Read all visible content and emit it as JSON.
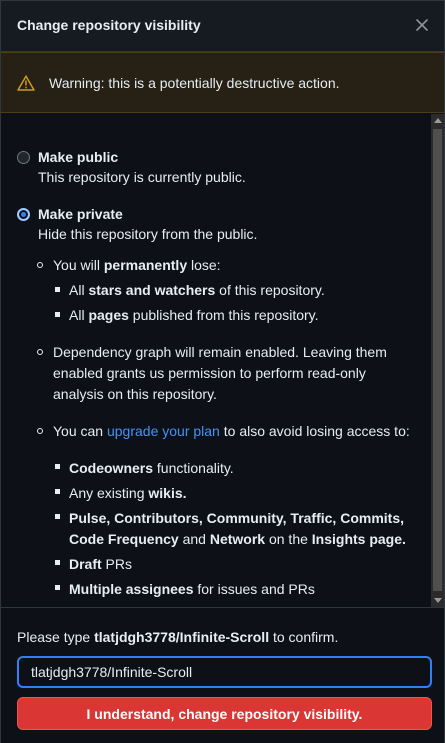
{
  "dialog": {
    "title": "Change repository visibility",
    "close_icon": "close-icon"
  },
  "warning": {
    "icon": "alert-triangle-icon",
    "text": "Warning: this is a potentially destructive action."
  },
  "options": {
    "public": {
      "label": "Make public",
      "note": "This repository is currently public.",
      "checked": false
    },
    "private": {
      "label": "Make private",
      "note": "Hide this repository from the public.",
      "checked": true
    }
  },
  "details": {
    "lose_intro": {
      "pre": "You will ",
      "bold": "permanently",
      "post": " lose:"
    },
    "lose_items": [
      {
        "pre": "All ",
        "bold": "stars and watchers",
        "post": " of this repository."
      },
      {
        "pre": "All ",
        "bold": "pages",
        "post": " published from this repository."
      }
    ],
    "dependency_lines": [
      "Dependency graph will remain enabled. Leaving them",
      "enabled grants us permission to perform read-only",
      "analysis on this repository."
    ],
    "upgrade": {
      "pre": "You can ",
      "link": "upgrade your plan",
      "post": " to also avoid losing access to:"
    },
    "upgrade_items": {
      "codeowners": {
        "bold": "Codeowners",
        "post": " functionality."
      },
      "wikis": {
        "pre": "Any existing ",
        "bold": "wikis."
      },
      "insights_line1": "Pulse, Contributors, Community, Traffic, Commits,",
      "insights_line2": {
        "b1": "Code Frequency",
        "mid1": " and ",
        "b2": "Network",
        "mid2": " on the ",
        "b3": "Insights page."
      },
      "draft": {
        "bold": "Draft",
        "post": " PRs"
      },
      "assignees": {
        "bold": "Multiple assignees",
        "post": " for issues and PRs"
      }
    }
  },
  "confirm": {
    "pre": "Please type ",
    "repo": "tlatjdgh3778/Infinite-Scroll",
    "post": " to confirm.",
    "input_value": "tlatjdgh3778/Infinite-Scroll",
    "button_label": "I understand, change repository visibility."
  },
  "colors": {
    "accent": "#2f81f7",
    "link": "#4493f8",
    "danger": "#da3633",
    "warning_bg": "#272115"
  }
}
